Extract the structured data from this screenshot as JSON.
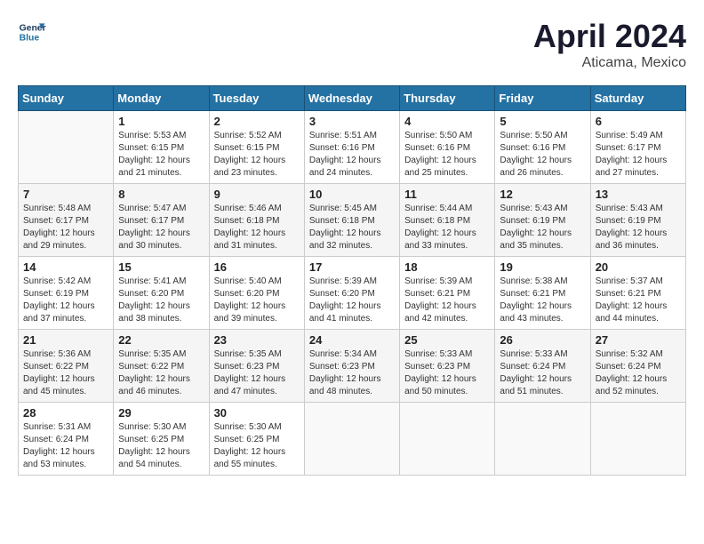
{
  "header": {
    "logo_line1": "General",
    "logo_line2": "Blue",
    "month": "April 2024",
    "location": "Aticama, Mexico"
  },
  "weekdays": [
    "Sunday",
    "Monday",
    "Tuesday",
    "Wednesday",
    "Thursday",
    "Friday",
    "Saturday"
  ],
  "weeks": [
    [
      {
        "day": "",
        "info": ""
      },
      {
        "day": "1",
        "info": "Sunrise: 5:53 AM\nSunset: 6:15 PM\nDaylight: 12 hours\nand 21 minutes."
      },
      {
        "day": "2",
        "info": "Sunrise: 5:52 AM\nSunset: 6:15 PM\nDaylight: 12 hours\nand 23 minutes."
      },
      {
        "day": "3",
        "info": "Sunrise: 5:51 AM\nSunset: 6:16 PM\nDaylight: 12 hours\nand 24 minutes."
      },
      {
        "day": "4",
        "info": "Sunrise: 5:50 AM\nSunset: 6:16 PM\nDaylight: 12 hours\nand 25 minutes."
      },
      {
        "day": "5",
        "info": "Sunrise: 5:50 AM\nSunset: 6:16 PM\nDaylight: 12 hours\nand 26 minutes."
      },
      {
        "day": "6",
        "info": "Sunrise: 5:49 AM\nSunset: 6:17 PM\nDaylight: 12 hours\nand 27 minutes."
      }
    ],
    [
      {
        "day": "7",
        "info": "Sunrise: 5:48 AM\nSunset: 6:17 PM\nDaylight: 12 hours\nand 29 minutes."
      },
      {
        "day": "8",
        "info": "Sunrise: 5:47 AM\nSunset: 6:17 PM\nDaylight: 12 hours\nand 30 minutes."
      },
      {
        "day": "9",
        "info": "Sunrise: 5:46 AM\nSunset: 6:18 PM\nDaylight: 12 hours\nand 31 minutes."
      },
      {
        "day": "10",
        "info": "Sunrise: 5:45 AM\nSunset: 6:18 PM\nDaylight: 12 hours\nand 32 minutes."
      },
      {
        "day": "11",
        "info": "Sunrise: 5:44 AM\nSunset: 6:18 PM\nDaylight: 12 hours\nand 33 minutes."
      },
      {
        "day": "12",
        "info": "Sunrise: 5:43 AM\nSunset: 6:19 PM\nDaylight: 12 hours\nand 35 minutes."
      },
      {
        "day": "13",
        "info": "Sunrise: 5:43 AM\nSunset: 6:19 PM\nDaylight: 12 hours\nand 36 minutes."
      }
    ],
    [
      {
        "day": "14",
        "info": "Sunrise: 5:42 AM\nSunset: 6:19 PM\nDaylight: 12 hours\nand 37 minutes."
      },
      {
        "day": "15",
        "info": "Sunrise: 5:41 AM\nSunset: 6:20 PM\nDaylight: 12 hours\nand 38 minutes."
      },
      {
        "day": "16",
        "info": "Sunrise: 5:40 AM\nSunset: 6:20 PM\nDaylight: 12 hours\nand 39 minutes."
      },
      {
        "day": "17",
        "info": "Sunrise: 5:39 AM\nSunset: 6:20 PM\nDaylight: 12 hours\nand 41 minutes."
      },
      {
        "day": "18",
        "info": "Sunrise: 5:39 AM\nSunset: 6:21 PM\nDaylight: 12 hours\nand 42 minutes."
      },
      {
        "day": "19",
        "info": "Sunrise: 5:38 AM\nSunset: 6:21 PM\nDaylight: 12 hours\nand 43 minutes."
      },
      {
        "day": "20",
        "info": "Sunrise: 5:37 AM\nSunset: 6:21 PM\nDaylight: 12 hours\nand 44 minutes."
      }
    ],
    [
      {
        "day": "21",
        "info": "Sunrise: 5:36 AM\nSunset: 6:22 PM\nDaylight: 12 hours\nand 45 minutes."
      },
      {
        "day": "22",
        "info": "Sunrise: 5:35 AM\nSunset: 6:22 PM\nDaylight: 12 hours\nand 46 minutes."
      },
      {
        "day": "23",
        "info": "Sunrise: 5:35 AM\nSunset: 6:23 PM\nDaylight: 12 hours\nand 47 minutes."
      },
      {
        "day": "24",
        "info": "Sunrise: 5:34 AM\nSunset: 6:23 PM\nDaylight: 12 hours\nand 48 minutes."
      },
      {
        "day": "25",
        "info": "Sunrise: 5:33 AM\nSunset: 6:23 PM\nDaylight: 12 hours\nand 50 minutes."
      },
      {
        "day": "26",
        "info": "Sunrise: 5:33 AM\nSunset: 6:24 PM\nDaylight: 12 hours\nand 51 minutes."
      },
      {
        "day": "27",
        "info": "Sunrise: 5:32 AM\nSunset: 6:24 PM\nDaylight: 12 hours\nand 52 minutes."
      }
    ],
    [
      {
        "day": "28",
        "info": "Sunrise: 5:31 AM\nSunset: 6:24 PM\nDaylight: 12 hours\nand 53 minutes."
      },
      {
        "day": "29",
        "info": "Sunrise: 5:30 AM\nSunset: 6:25 PM\nDaylight: 12 hours\nand 54 minutes."
      },
      {
        "day": "30",
        "info": "Sunrise: 5:30 AM\nSunset: 6:25 PM\nDaylight: 12 hours\nand 55 minutes."
      },
      {
        "day": "",
        "info": ""
      },
      {
        "day": "",
        "info": ""
      },
      {
        "day": "",
        "info": ""
      },
      {
        "day": "",
        "info": ""
      }
    ]
  ]
}
